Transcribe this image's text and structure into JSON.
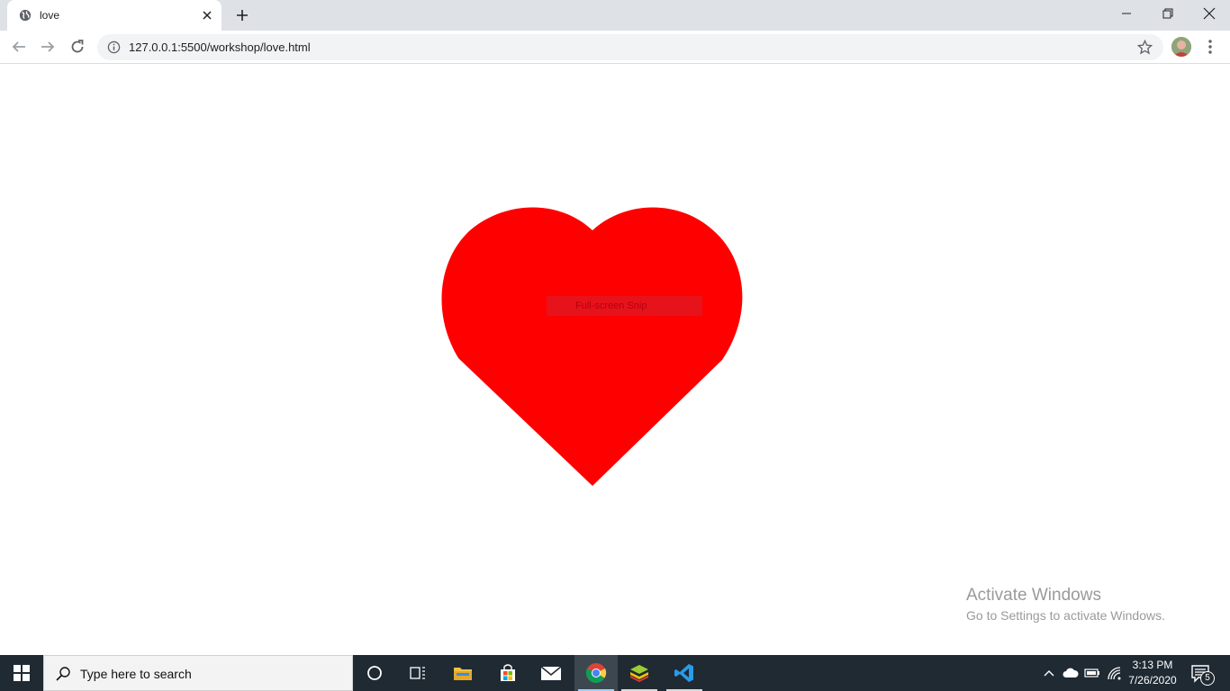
{
  "browser": {
    "tab": {
      "title": "love",
      "favicon": "globe-icon"
    },
    "address": {
      "url": "127.0.0.1:5500/workshop/love.html"
    },
    "icons": [
      "back-arrow-icon",
      "forward-arrow-icon",
      "reload-icon",
      "info-icon",
      "star-icon",
      "kebab-menu-icon"
    ]
  },
  "page": {
    "heart_color": "#ff0000",
    "snip_label": "Full-screen Snip"
  },
  "watermark": {
    "title": "Activate Windows",
    "subtitle": "Go to Settings to activate Windows."
  },
  "taskbar": {
    "search_placeholder": "Type here to search",
    "apps": [
      "cortana",
      "task-view",
      "file-explorer",
      "microsoft-store",
      "mail",
      "chrome",
      "bluestacks",
      "vscode"
    ],
    "active_app": "chrome",
    "clock": {
      "time": "3:13 PM",
      "date": "7/26/2020"
    },
    "notification_count": "5"
  }
}
